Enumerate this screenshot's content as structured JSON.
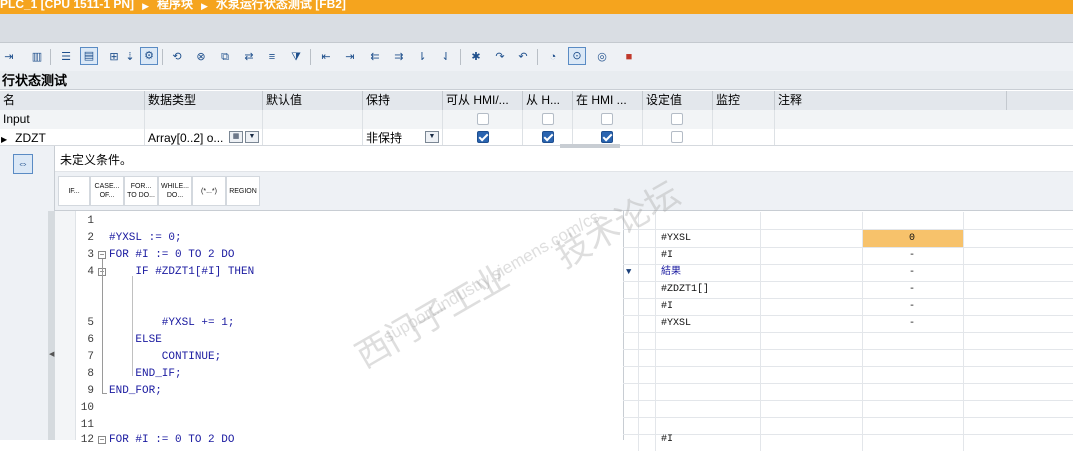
{
  "breadcrumb": {
    "item1": "PLC_1 [CPU 1511-1 PN]",
    "item2": "程序块",
    "item3": "水泵运行状态测试 [FB2]"
  },
  "block": {
    "title": "行状态测试"
  },
  "interface": {
    "headers": [
      "名",
      "数据类型",
      "默认值",
      "保持",
      "可从 HMI/...",
      "从 H...",
      "在 HMI ...",
      "设定值",
      "监控",
      "注释"
    ],
    "rows": [
      {
        "name": "Input",
        "type": "",
        "retain": ""
      },
      {
        "name": "ZDZT",
        "type": "Array[0..2] o...",
        "retain": "非保持",
        "checks": {
          "hmi_access": true,
          "hmi_visible": true,
          "hmi_write": true,
          "setpoint": false
        }
      }
    ]
  },
  "editor": {
    "comment": "未定义条件。",
    "templates": [
      {
        "id": "if",
        "label": "IF..."
      },
      {
        "id": "case",
        "label": "CASE...\nOF..."
      },
      {
        "id": "for",
        "label": "FOR...\nTO DO..."
      },
      {
        "id": "while",
        "label": "WHILE...\nDO..."
      },
      {
        "id": "comment",
        "label": "(*...*)"
      },
      {
        "id": "region",
        "label": "REGION"
      }
    ],
    "lines": [
      {
        "num": "1",
        "text": ""
      },
      {
        "num": "2",
        "text": "#YXSL := 0;"
      },
      {
        "num": "3",
        "text": "FOR #I := 0 TO 2 DO"
      },
      {
        "num": "4",
        "text": "    IF #ZDZT1[#I] THEN"
      },
      {
        "num": "5",
        "text": "        #YXSL += 1;"
      },
      {
        "num": "6",
        "text": "    ELSE"
      },
      {
        "num": "7",
        "text": "        CONTINUE;"
      },
      {
        "num": "8",
        "text": "    END_IF;"
      },
      {
        "num": "9",
        "text": "END_FOR;"
      },
      {
        "num": "10",
        "text": ""
      },
      {
        "num": "11",
        "text": ""
      },
      {
        "num": "12",
        "text": "FOR #I := 0 TO 2 DO"
      }
    ]
  },
  "monitor": {
    "rows": [
      {
        "name": "",
        "value": ""
      },
      {
        "name": "#YXSL",
        "value": "0"
      },
      {
        "name": "#I",
        "value": "-"
      },
      {
        "name": "結果",
        "value": "-"
      },
      {
        "name": "#ZDZT1[]",
        "value": "-"
      },
      {
        "name": "#I",
        "value": "-"
      },
      {
        "name": "#YXSL",
        "value": "-"
      },
      {
        "name": "",
        "value": ""
      },
      {
        "name": "",
        "value": ""
      },
      {
        "name": "",
        "value": ""
      },
      {
        "name": "",
        "value": ""
      },
      {
        "name": "",
        "value": ""
      },
      {
        "name": "#I",
        "value": ""
      }
    ],
    "highlight_color": "#f7c26b"
  },
  "watermark": {
    "line1": "西门子工业",
    "line2": "support.industry.siemens.com/cs",
    "line3": "技术论坛"
  },
  "colors": {
    "title_bar": "#f5a41e",
    "code_text": "#1a1aa0",
    "check_on": "#2a64b0"
  }
}
